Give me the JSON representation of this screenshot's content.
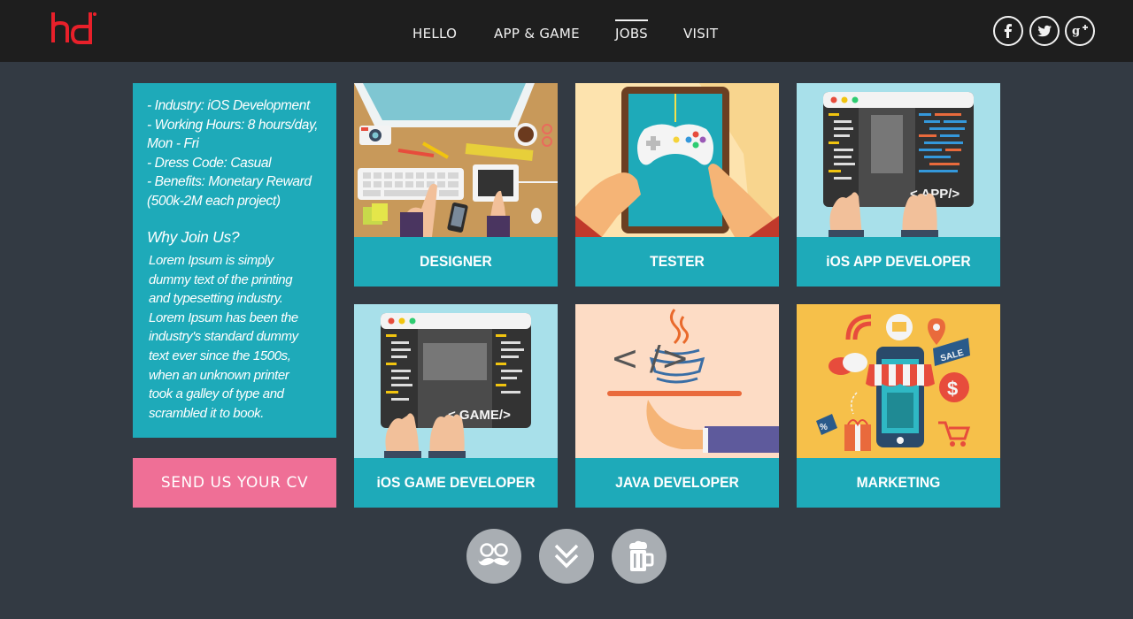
{
  "header": {
    "logo_text": "hd",
    "nav": [
      {
        "label": "HELLO",
        "active": false
      },
      {
        "label": "APP & GAME",
        "active": false
      },
      {
        "label": "JOBS",
        "active": true
      },
      {
        "label": "VISIT",
        "active": false
      }
    ],
    "social": [
      "facebook-icon",
      "twitter-icon",
      "google-plus-icon"
    ]
  },
  "info": {
    "lines": [
      "- Industry: iOS Development",
      "- Working Hours: 8 hours/day,",
      "Mon - Fri",
      "- Dress Code: Casual",
      "- Benefits: Monetary Reward",
      "(500k-2M each project)"
    ],
    "why_title": "Why Join Us?",
    "why_lines": [
      "Lorem Ipsum is simply",
      "dummy text of the printing",
      "and typesetting industry.",
      "Lorem Ipsum has been the",
      "industry's standard dummy",
      "text ever since the 1500s,",
      "when an unknown printer",
      "took a galley of type and",
      "scrambled it to book."
    ]
  },
  "cv_button": "SEND US YOUR CV",
  "jobs": [
    {
      "label": "DESIGNER"
    },
    {
      "label": "TESTER"
    },
    {
      "label": "iOS APP DEVELOPER",
      "badge": "< APP/>"
    },
    {
      "label": "iOS GAME DEVELOPER",
      "badge": "< GAME/>"
    },
    {
      "label": "JAVA DEVELOPER",
      "code": "< />"
    },
    {
      "label": "MARKETING",
      "sale": "SALE",
      "dollar": "$",
      "percent": "%"
    }
  ],
  "colors": {
    "teal": "#1eaab9",
    "pink": "#ef6f96",
    "background": "#333a43",
    "header": "#1e1e1e",
    "logo": "#e8202a"
  },
  "bottom_icons": [
    "mustache-glasses-icon",
    "double-chevron-down-icon",
    "beer-mug-icon"
  ]
}
